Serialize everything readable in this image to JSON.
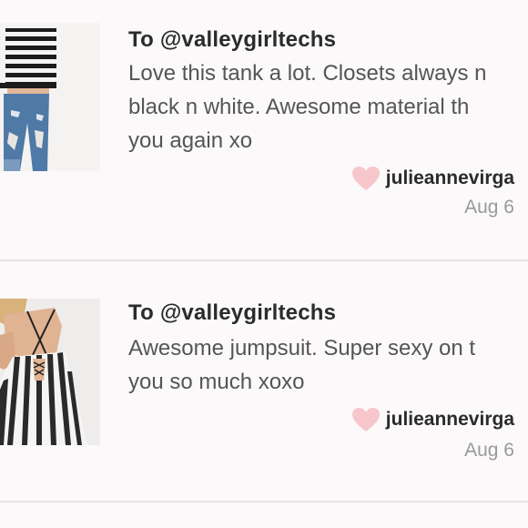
{
  "notes": [
    {
      "to_prefix": "To",
      "to_handle": "@valleygirltechs",
      "message_lines": [
        "Love this tank a lot. Closets always n",
        "black n white. Awesome material th",
        "you again xo"
      ],
      "author": "julieannevirga",
      "date": "Aug 6",
      "image": "striped-tank-and-jeans-photo"
    },
    {
      "to_prefix": "To",
      "to_handle": "@valleygirltechs",
      "message_lines": [
        "Awesome jumpsuit. Super sexy on t",
        "you so much xoxo"
      ],
      "author": "julieannevirga",
      "date": "Aug 6",
      "image": "striped-jumpsuit-photo"
    }
  ],
  "colors": {
    "heart": "#f7c6cb",
    "divider": "#e6e3e5",
    "date": "#9a9a9a",
    "background": "#fbf9fa"
  }
}
